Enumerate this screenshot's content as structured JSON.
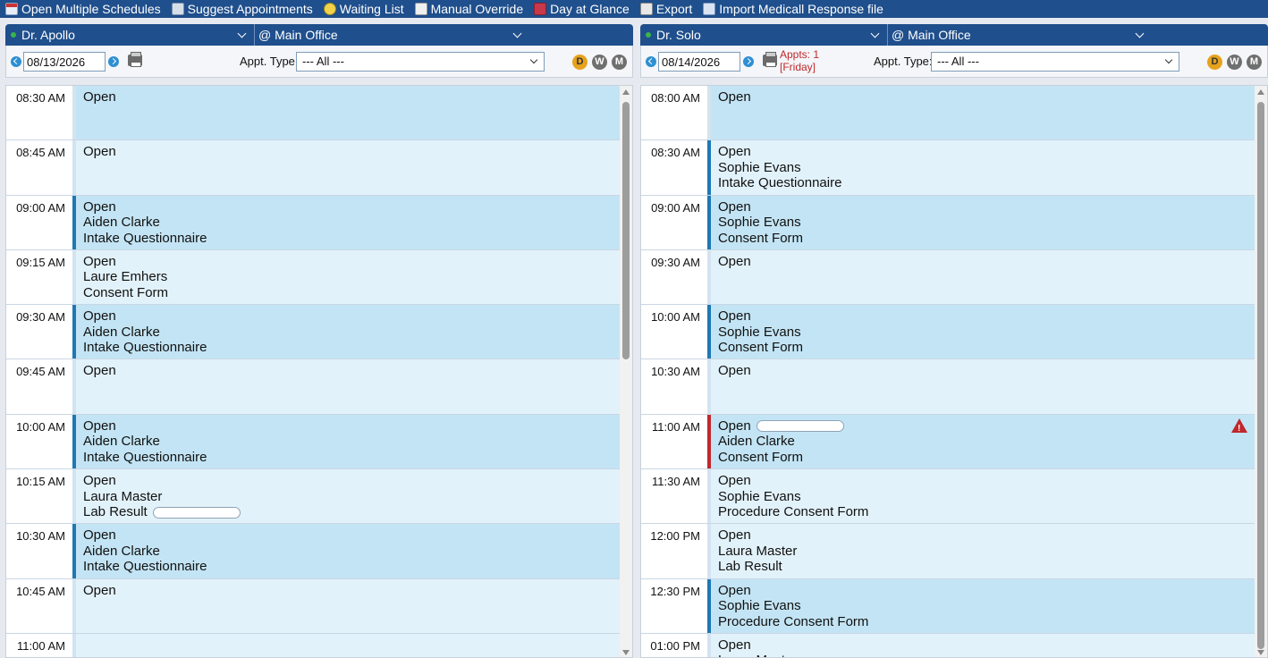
{
  "toolbar": {
    "items": [
      {
        "label": "Open Multiple Schedules",
        "icon": "calendar-icon"
      },
      {
        "label": "Suggest Appointments",
        "icon": "suggest-icon"
      },
      {
        "label": "Waiting List",
        "icon": "clock-icon"
      },
      {
        "label": "Manual Override",
        "icon": "override-icon"
      },
      {
        "label": "Day at Glance",
        "icon": "grid-calendar-icon"
      },
      {
        "label": "Export",
        "icon": "export-icon"
      },
      {
        "label": "Import Medicall Response file",
        "icon": "import-icon"
      }
    ]
  },
  "left": {
    "provider": "Dr. Apollo",
    "location": "@ Main Office",
    "date": "08/13/2026",
    "appt_type_label": "Appt. Type:",
    "appt_type_value": "--- All ---",
    "views": [
      "D",
      "W",
      "M"
    ],
    "slots": [
      {
        "time": "08:30 AM",
        "status": "Open",
        "patient": "",
        "form": "",
        "shade": "dark",
        "bar": "none"
      },
      {
        "time": "08:45 AM",
        "status": "Open",
        "patient": "",
        "form": "",
        "shade": "light",
        "bar": "none"
      },
      {
        "time": "09:00 AM",
        "status": "Open",
        "patient": "Aiden Clarke",
        "form": "Intake Questionnaire",
        "shade": "dark",
        "bar": "blue"
      },
      {
        "time": "09:15 AM",
        "status": "Open",
        "patient": "Laure Emhers",
        "form": "Consent Form",
        "shade": "light",
        "bar": "none"
      },
      {
        "time": "09:30 AM",
        "status": "Open",
        "patient": "Aiden Clarke",
        "form": "Intake Questionnaire",
        "shade": "dark",
        "bar": "blue"
      },
      {
        "time": "09:45 AM",
        "status": "Open",
        "patient": "",
        "form": "",
        "shade": "light",
        "bar": "none"
      },
      {
        "time": "10:00 AM",
        "status": "Open",
        "patient": "Aiden Clarke",
        "form": "Intake Questionnaire",
        "shade": "dark",
        "bar": "blue"
      },
      {
        "time": "10:15 AM",
        "status": "Open",
        "patient": "Laura Master",
        "form": "Lab Result",
        "shade": "light",
        "bar": "none",
        "pill_on_form": true
      },
      {
        "time": "10:30 AM",
        "status": "Open",
        "patient": "Aiden Clarke",
        "form": "Intake Questionnaire",
        "shade": "dark",
        "bar": "blue"
      },
      {
        "time": "10:45 AM",
        "status": "Open",
        "patient": "",
        "form": "",
        "shade": "light",
        "bar": "none"
      },
      {
        "time": "11:00 AM",
        "status": "",
        "patient": "",
        "form": "",
        "shade": "light",
        "bar": "none"
      }
    ]
  },
  "right": {
    "provider": "Dr. Solo",
    "location": "@ Main Office",
    "date": "08/14/2026",
    "appts_count": "Appts: 1",
    "appts_day": "[Friday]",
    "appt_type_label": "Appt. Type:",
    "appt_type_value": "--- All ---",
    "views": [
      "D",
      "W",
      "M"
    ],
    "slots": [
      {
        "time": "08:00 AM",
        "status": "Open",
        "patient": "",
        "form": "",
        "shade": "dark",
        "bar": "none"
      },
      {
        "time": "08:30 AM",
        "status": "Open",
        "patient": "Sophie Evans",
        "form": "Intake Questionnaire",
        "shade": "light",
        "bar": "blue"
      },
      {
        "time": "09:00 AM",
        "status": "Open",
        "patient": "Sophie Evans",
        "form": "Consent Form",
        "shade": "dark",
        "bar": "blue"
      },
      {
        "time": "09:30 AM",
        "status": "Open",
        "patient": "",
        "form": "",
        "shade": "light",
        "bar": "none"
      },
      {
        "time": "10:00 AM",
        "status": "Open",
        "patient": "Sophie Evans",
        "form": "Consent Form",
        "shade": "dark",
        "bar": "blue"
      },
      {
        "time": "10:30 AM",
        "status": "Open",
        "patient": "",
        "form": "",
        "shade": "light",
        "bar": "none"
      },
      {
        "time": "11:00 AM",
        "status": "Open",
        "patient": "Aiden Clarke",
        "form": "Consent Form",
        "shade": "dark",
        "bar": "red",
        "pill_on_status": true,
        "warning": true
      },
      {
        "time": "11:30 AM",
        "status": "Open",
        "patient": "Sophie Evans",
        "form": "Procedure Consent Form",
        "shade": "light",
        "bar": "none"
      },
      {
        "time": "12:00 PM",
        "status": "Open",
        "patient": "Laura Master",
        "form": "Lab Result",
        "shade": "light",
        "bar": "none"
      },
      {
        "time": "12:30 PM",
        "status": "Open",
        "patient": "Sophie Evans",
        "form": "Procedure Consent Form",
        "shade": "dark",
        "bar": "blue"
      },
      {
        "time": "01:00 PM",
        "status": "Open",
        "patient": "Laura Master",
        "form": "",
        "shade": "light",
        "bar": "none"
      }
    ]
  },
  "colors": {
    "header_blue": "#1f4f8c",
    "slot_dark": "#c3e4f4",
    "slot_light": "#e2f2fa",
    "bar_blue": "#1f78b4",
    "bar_red": "#c0282c",
    "alert_text": "#c0282c"
  }
}
